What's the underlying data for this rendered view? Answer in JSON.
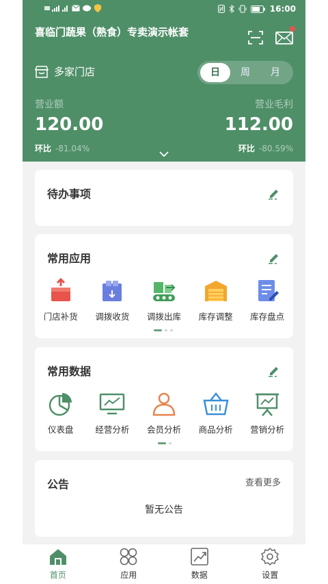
{
  "status_bar": {
    "time": "16:00"
  },
  "header": {
    "shop_title": "喜临门蔬果（熟食）专卖演示帐套",
    "store_selector": "多家门店",
    "period_tabs": [
      {
        "label": "日",
        "active": true
      },
      {
        "label": "周",
        "active": false
      },
      {
        "label": "月",
        "active": false
      }
    ],
    "revenue": {
      "label": "营业额",
      "value": "120.00",
      "ratio_label": "环比",
      "ratio_value": "-81.04%"
    },
    "gross_profit": {
      "label": "营业毛利",
      "value": "112.00",
      "ratio_label": "环比",
      "ratio_value": "-80.59%"
    }
  },
  "todo": {
    "title": "待办事项"
  },
  "apps": {
    "title": "常用应用",
    "items": [
      {
        "label": "门店补货",
        "icon": "restock-box-icon"
      },
      {
        "label": "调拨收货",
        "icon": "transfer-receive-icon"
      },
      {
        "label": "调拨出库",
        "icon": "transfer-out-icon"
      },
      {
        "label": "库存调整",
        "icon": "warehouse-icon"
      },
      {
        "label": "库存盘点",
        "icon": "inventory-check-icon"
      }
    ]
  },
  "data_section": {
    "title": "常用数据",
    "items": [
      {
        "label": "仪表盘",
        "icon": "pie-chart-icon"
      },
      {
        "label": "经营分析",
        "icon": "monitor-chart-icon"
      },
      {
        "label": "会员分析",
        "icon": "member-icon"
      },
      {
        "label": "商品分析",
        "icon": "basket-icon"
      },
      {
        "label": "营销分析",
        "icon": "presentation-board-icon"
      }
    ]
  },
  "notice": {
    "title": "公告",
    "more": "查看更多",
    "empty_text": "暂无公告"
  },
  "tabbar": [
    {
      "label": "首页",
      "icon": "home-icon",
      "active": true
    },
    {
      "label": "应用",
      "icon": "apps-icon",
      "active": false
    },
    {
      "label": "数据",
      "icon": "chart-icon",
      "active": false
    },
    {
      "label": "设置",
      "icon": "gear-icon",
      "active": false
    }
  ],
  "colors": {
    "brand": "#4f8f68",
    "badge": "#e8534c"
  }
}
